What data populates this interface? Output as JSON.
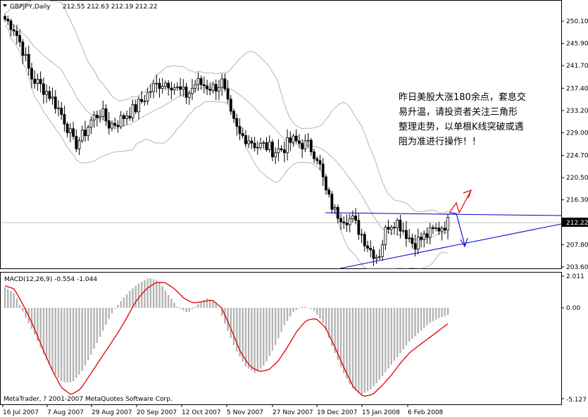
{
  "header": {
    "symbol": "GBPJPY,Daily",
    "ohlc": "212.55 212.63 212.19 212.22"
  },
  "annotation": {
    "lines": [
      "昨日美股大涨180余点，套息交",
      "易升温，请投资者关注三角形",
      "整理走势，以单根K线突破或遇",
      "阻为准进行操作！！"
    ]
  },
  "macd": {
    "label": "MACD(12,26,9) -0.554 -1.044",
    "scale_labels": [
      "2.011",
      "0.00",
      "-5.127"
    ]
  },
  "copyright": "MetaTrader, ? 2001-2007 MetaQuotes Software Corp.",
  "colors": {
    "candle": "#000000",
    "bollinger": "#b4b4b4",
    "trendline": "#0000cc",
    "arrow_up": "#e00000",
    "arrow_down": "#1010d0",
    "histogram": "#b4b4b4",
    "signal": "#e00000",
    "current_price_line": "#c0c0c0"
  },
  "chart_data": {
    "type": "candlestick",
    "title": "GBPJPY,Daily",
    "price_ticks": [
      "250.10",
      "245.90",
      "241.70",
      "237.40",
      "233.20",
      "229.00",
      "224.70",
      "220.50",
      "216.30",
      "207.80",
      "203.60"
    ],
    "current_price": "212.22",
    "ylim": [
      203.6,
      252.0
    ],
    "x_tick_labels": [
      "16 Jul 2007",
      "7 Aug 2007",
      "29 Aug 2007",
      "20 Sep 2007",
      "12 Oct 2007",
      "5 Nov 2007",
      "27 Nov 2007",
      "19 Dec 2007",
      "15 Jan 2008",
      "6 Feb 2008"
    ],
    "close_path": [
      250.5,
      249.0,
      245.0,
      239.5,
      238.0,
      236.5,
      234.0,
      231.0,
      226.5,
      228.5,
      231.5,
      233.0,
      230.5,
      231.0,
      232.5,
      233.5,
      235.5,
      237.5,
      238.5,
      238.5,
      237.0,
      236.0,
      238.5,
      238.0,
      237.5,
      238.5,
      232.0,
      228.5,
      228.0,
      226.5,
      226.5,
      225.5,
      226.0,
      227.5,
      227.0,
      226.5,
      224.5,
      217.5,
      214.0,
      213.0,
      212.5,
      210.0,
      207.0,
      205.5,
      211.5,
      212.5,
      210.5,
      208.0,
      209.0,
      210.0,
      211.0,
      212.0
    ],
    "macd_histogram_path": [
      1.3,
      0.9,
      -0.4,
      -1.4,
      -2.6,
      -3.6,
      -4.2,
      -4.2,
      -3.6,
      -2.6,
      -1.5,
      -0.4,
      0.4,
      1.1,
      1.6,
      1.9,
      1.7,
      0.8,
      0.0,
      -0.3,
      0.2,
      0.6,
      0.3,
      -1.1,
      -2.4,
      -3.3,
      -3.7,
      -3.2,
      -2.2,
      -1.0,
      -0.2,
      0.1,
      -0.1,
      -0.8,
      -2.2,
      -3.5,
      -4.5,
      -4.9,
      -4.6,
      -4.0,
      -3.3,
      -2.6,
      -1.9,
      -1.4,
      -0.9,
      -0.6,
      -0.4
    ],
    "macd_signal_path": [
      1.4,
      1.2,
      0.1,
      -1.0,
      -2.3,
      -3.5,
      -4.5,
      -4.9,
      -4.6,
      -3.8,
      -3.0,
      -2.2,
      -1.4,
      -0.5,
      0.5,
      1.2,
      1.6,
      1.6,
      1.2,
      0.6,
      0.3,
      0.4,
      0.5,
      0.0,
      -1.2,
      -2.5,
      -3.3,
      -3.6,
      -3.5,
      -3.0,
      -2.2,
      -1.3,
      -0.7,
      -0.6,
      -1.1,
      -2.2,
      -3.4,
      -4.5,
      -5.0,
      -4.9,
      -4.4,
      -3.8,
      -3.1,
      -2.5,
      -2.1,
      -1.7,
      -1.3,
      -0.9
    ]
  }
}
